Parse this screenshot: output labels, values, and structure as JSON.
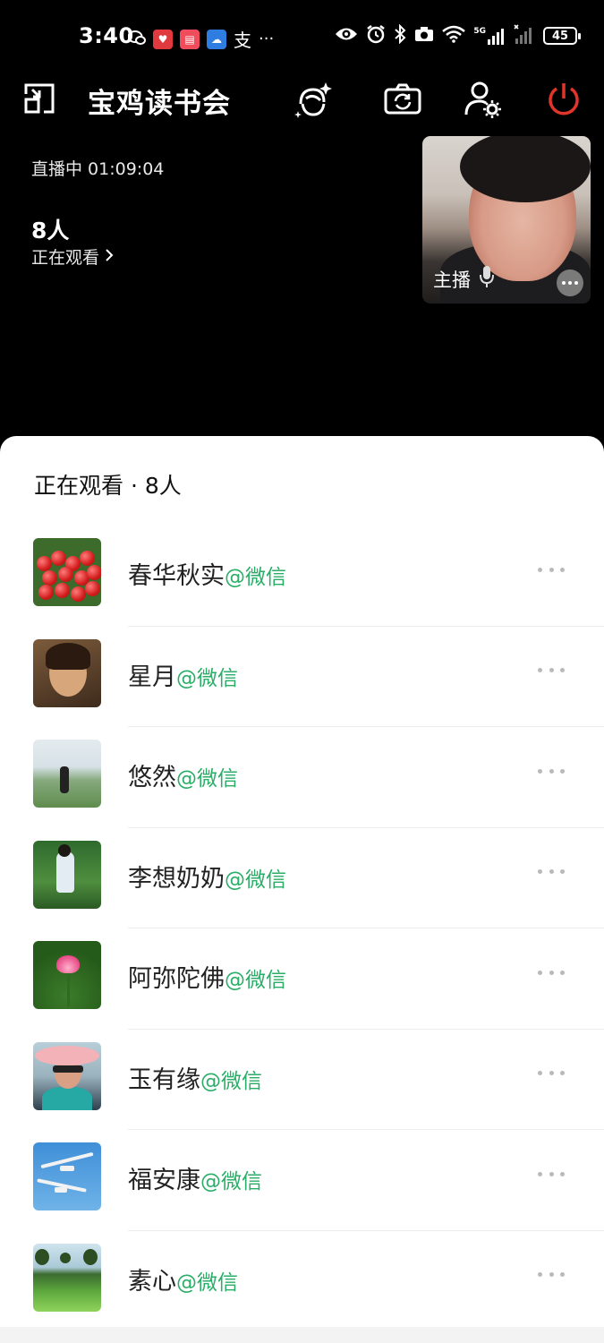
{
  "status_bar": {
    "time": "3:40",
    "notification_icons": [
      "wechat-icon",
      "app-red-icon",
      "app-book-icon",
      "cloud-icon",
      "alipay-icon"
    ],
    "more_notifications": "···",
    "right_icons": [
      "eye-icon",
      "alarm-icon",
      "bluetooth-icon",
      "camera-icon",
      "wifi-icon",
      "signal-5g-icon",
      "signal-icon"
    ],
    "network_label": "5G",
    "battery": "45"
  },
  "header": {
    "room_title": "宝鸡读书会",
    "icons": [
      "exit-window-icon",
      "beauty-filter-icon",
      "flip-camera-icon",
      "user-settings-icon",
      "power-icon"
    ],
    "power_color": "#e0352b"
  },
  "live": {
    "status": "直播中 01:09:04",
    "viewer_count": "8人",
    "viewers_link": "正在观看"
  },
  "host": {
    "label": "主播"
  },
  "sheet": {
    "title": "正在观看 · 8人",
    "accent_color": "#2aae67",
    "viewers": [
      {
        "name": "春华秋实",
        "tag": "@微信",
        "avatar": "cherries"
      },
      {
        "name": "星月",
        "tag": "@微信",
        "avatar": "woman-portrait"
      },
      {
        "name": "悠然",
        "tag": "@微信",
        "avatar": "field"
      },
      {
        "name": "李想奶奶",
        "tag": "@微信",
        "avatar": "lotus-pond"
      },
      {
        "name": "阿弥陀佛",
        "tag": "@微信",
        "avatar": "lotus-flower"
      },
      {
        "name": "玉有缘",
        "tag": "@微信",
        "avatar": "woman-hat"
      },
      {
        "name": "福安康",
        "tag": "@微信",
        "avatar": "seagulls"
      },
      {
        "name": "素心",
        "tag": "@微信",
        "avatar": "garden"
      }
    ]
  }
}
